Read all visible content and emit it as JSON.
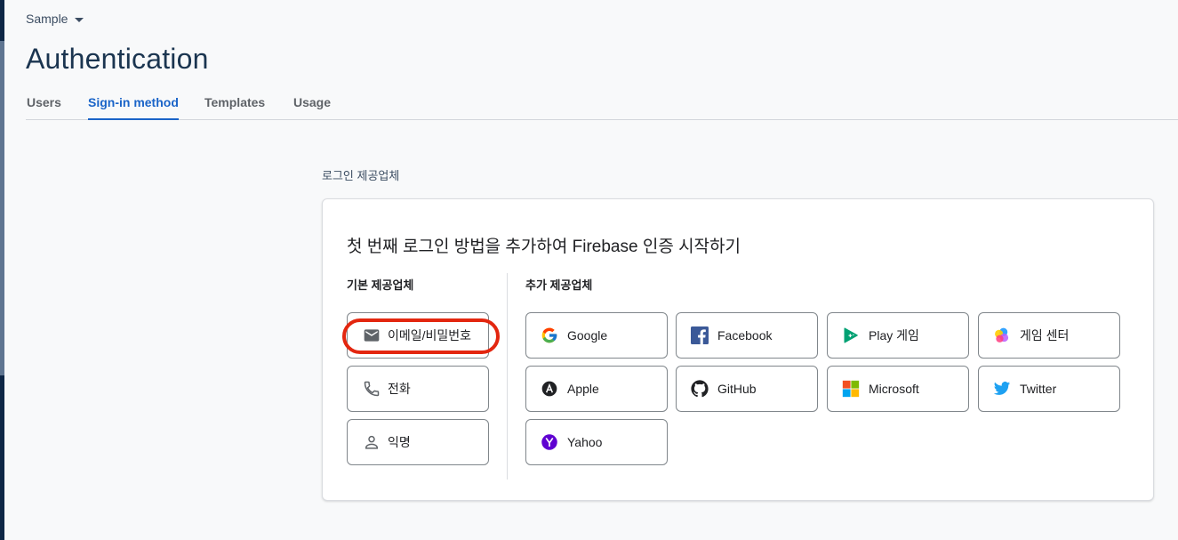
{
  "project": {
    "name": "Sample"
  },
  "page": {
    "title": "Authentication"
  },
  "tabs": [
    {
      "label": "Users"
    },
    {
      "label": "Sign-in method"
    },
    {
      "label": "Templates"
    },
    {
      "label": "Usage"
    }
  ],
  "section": {
    "label": "로그인 제공업체"
  },
  "card": {
    "title": "첫 번째 로그인 방법을 추가하여 Firebase 인증 시작하기",
    "basic_title": "기본 제공업체",
    "extra_title": "추가 제공업체"
  },
  "basic_providers": [
    {
      "label": "이메일/비밀번호",
      "icon": "mail-icon"
    },
    {
      "label": "전화",
      "icon": "phone-icon"
    },
    {
      "label": "익명",
      "icon": "person-icon"
    }
  ],
  "extra_providers": [
    {
      "label": "Google",
      "icon": "google-icon"
    },
    {
      "label": "Facebook",
      "icon": "facebook-icon"
    },
    {
      "label": "Play 게임",
      "icon": "play-games-icon"
    },
    {
      "label": "게임 센터",
      "icon": "game-center-icon"
    },
    {
      "label": "Apple",
      "icon": "apple-icon"
    },
    {
      "label": "GitHub",
      "icon": "github-icon"
    },
    {
      "label": "Microsoft",
      "icon": "microsoft-icon"
    },
    {
      "label": "Twitter",
      "icon": "twitter-icon"
    },
    {
      "label": "Yahoo",
      "icon": "yahoo-icon"
    }
  ],
  "colors": {
    "accent": "#1a64c8",
    "title": "#1b3550",
    "highlight": "#e3260f"
  }
}
